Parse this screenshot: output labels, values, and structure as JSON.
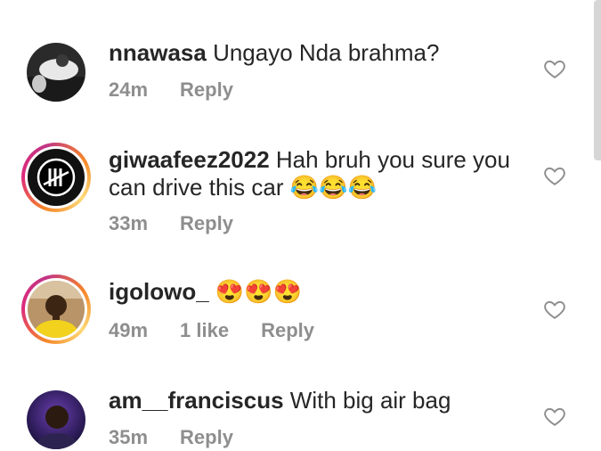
{
  "comments": [
    {
      "username": "nnawasa",
      "text": "Ungayo Nda brahma?",
      "time": "24m",
      "likes": "",
      "reply": "Reply",
      "avatar_ring": false
    },
    {
      "username": "giwaafeez2022",
      "text": "Hah bruh you sure you can drive this car 😂😂😂",
      "time": "33m",
      "likes": "",
      "reply": "Reply",
      "avatar_ring": true
    },
    {
      "username": "igolowo_",
      "text": "😍😍😍",
      "time": "49m",
      "likes": "1 like",
      "reply": "Reply",
      "avatar_ring": true
    },
    {
      "username": "am__franciscus",
      "text": "With big air bag",
      "time": "35m",
      "likes": "",
      "reply": "Reply",
      "avatar_ring": false
    }
  ],
  "icons": {
    "like": "heart-outline-icon"
  },
  "colors": {
    "text": "#262626",
    "meta": "#8e8e8e",
    "ring_start": "#f58529",
    "ring_end": "#dd2a7b"
  }
}
